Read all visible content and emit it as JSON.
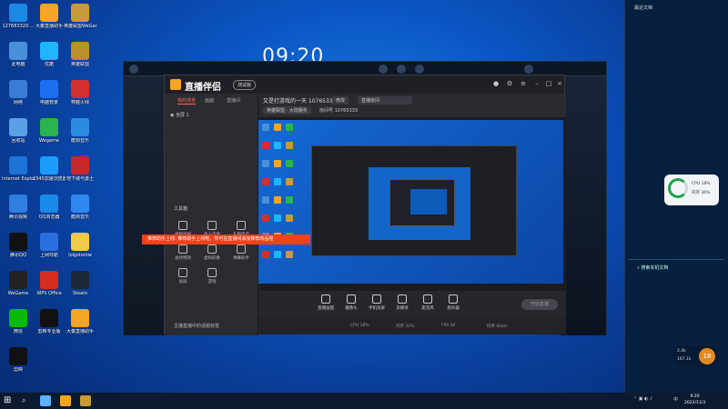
{
  "desktop": {
    "clock": "09:20",
    "icons": [
      {
        "label": "127683320 ...",
        "color": "#1e88e5"
      },
      {
        "label": "大秦直播助手",
        "color": "#f5a623"
      },
      {
        "label": "英雄联盟WeGame版",
        "color": "#c79c38"
      },
      {
        "label": "此电脑",
        "color": "#4a90d9"
      },
      {
        "label": "优酷",
        "color": "#1fb6ff"
      },
      {
        "label": "英雄联盟",
        "color": "#b8902c"
      },
      {
        "label": "网络",
        "color": "#3a7bd5"
      },
      {
        "label": "电脑管家",
        "color": "#1d6ff2"
      },
      {
        "label": "穿越火线",
        "color": "#d32f2f"
      },
      {
        "label": "回收站",
        "color": "#5aa0e6"
      },
      {
        "label": "Wegame",
        "color": "#2bb34f"
      },
      {
        "label": "酷狗音乐",
        "color": "#2c8be0"
      },
      {
        "label": "Internet Explorer",
        "color": "#1e74d6"
      },
      {
        "label": "2345加速浏览器",
        "color": "#1b9cfc"
      },
      {
        "label": "地下城与勇士",
        "color": "#c62828"
      },
      {
        "label": "腾讯视频",
        "color": "#2f7ee0"
      },
      {
        "label": "QQ浏览器",
        "color": "#1a8ae8"
      },
      {
        "label": "酷狗音乐",
        "color": "#2e88f0"
      },
      {
        "label": "腾讯QQ",
        "color": "#111111"
      },
      {
        "label": "上网导航",
        "color": "#2a6fe0"
      },
      {
        "label": "lolgstomw",
        "color": "#f2c94c"
      },
      {
        "label": "WeGame",
        "color": "#222222"
      },
      {
        "label": "WPS Office",
        "color": "#d62d20"
      },
      {
        "label": "Steam",
        "color": "#1a2838"
      },
      {
        "label": "微信",
        "color": "#09bb07"
      },
      {
        "label": "剪映专业版",
        "color": "#111111"
      },
      {
        "label": "大秦直播助手",
        "color": "#f5a623"
      },
      {
        "label": "剪映",
        "color": "#111111"
      }
    ]
  },
  "app": {
    "brand": "直播伴侣",
    "version": "测试版",
    "room_title": "又是打游戏的一天 10765333",
    "tags": [
      "修改",
      "直播房间",
      "英雄联盟 · 大陆服务"
    ],
    "stats": "房间号 10765333",
    "tabs": [
      "我的场景",
      "画面",
      "直播间"
    ],
    "scene_item": "全屏 1",
    "tools_label": "工具箱",
    "tools": [
      "视频连线",
      "多人连麦",
      "礼物显示",
      "进场特效",
      "虚拟形象",
      "弹幕助手",
      "录屏",
      "游戏"
    ],
    "bottom_buttons": [
      "直播画面",
      "摄像头",
      "手机投屏",
      "多媒体",
      "麦克风",
      "扬声器"
    ],
    "start_live": "开始直播",
    "footer_left": "主播直播中的话题标签",
    "status_items": [
      "CPU 18%",
      "内存 32%",
      "FPS 30",
      "码率 0kb/s"
    ]
  },
  "toast": {
    "text": "推荐助手上线: 推荐助手上线啦，你可在直播间添加推荐商品啦"
  },
  "right_panel": {
    "title": "最近文档",
    "cpu": "CPU 18%",
    "mem": "内存 36%",
    "search_hint": "搜索本机文档"
  },
  "net_widget": {
    "up": "2.4k",
    "down": "167.1k",
    "value": "18"
  },
  "taskbar": {
    "time": "9:20",
    "date": "2022/11/3",
    "lang": "中"
  }
}
